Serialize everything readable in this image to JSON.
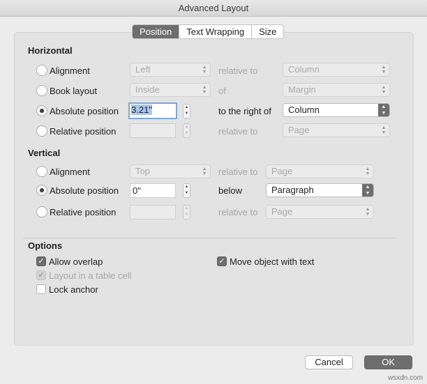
{
  "window": {
    "title": "Advanced Layout"
  },
  "tabs": [
    {
      "label": "Position",
      "active": true
    },
    {
      "label": "Text Wrapping",
      "active": false
    },
    {
      "label": "Size",
      "active": false
    }
  ],
  "horizontal": {
    "heading": "Horizontal",
    "rows": [
      {
        "option": "Alignment",
        "selected": false,
        "value": "Left",
        "relation": "relative to",
        "target": "Column"
      },
      {
        "option": "Book layout",
        "selected": false,
        "value": "Inside",
        "relation": "of",
        "target": "Margin"
      },
      {
        "option": "Absolute position",
        "selected": true,
        "value": "3.21\"",
        "relation": "to the right of",
        "target": "Column"
      },
      {
        "option": "Relative position",
        "selected": false,
        "value": "",
        "relation": "relative to",
        "target": "Page"
      }
    ]
  },
  "vertical": {
    "heading": "Vertical",
    "rows": [
      {
        "option": "Alignment",
        "selected": false,
        "value": "Top",
        "relation": "relative to",
        "target": "Page"
      },
      {
        "option": "Absolute position",
        "selected": true,
        "value": "0\"",
        "relation": "below",
        "target": "Paragraph"
      },
      {
        "option": "Relative position",
        "selected": false,
        "value": "",
        "relation": "relative to",
        "target": "Page"
      }
    ]
  },
  "options": {
    "heading": "Options",
    "allow_overlap": {
      "label": "Allow overlap",
      "checked": true
    },
    "layout_in_table_cell": {
      "label": "Layout in a table cell",
      "checked": true,
      "disabled": true
    },
    "lock_anchor": {
      "label": "Lock anchor",
      "checked": false
    },
    "move_with_text": {
      "label": "Move object with text",
      "checked": true
    }
  },
  "buttons": {
    "cancel": "Cancel",
    "ok": "OK"
  },
  "watermark": "wsxdn.com",
  "colors": {
    "accent_dark": "#6e6e6e",
    "focus_ring": "#7fa6d6",
    "selection": "#a9c8ef"
  }
}
